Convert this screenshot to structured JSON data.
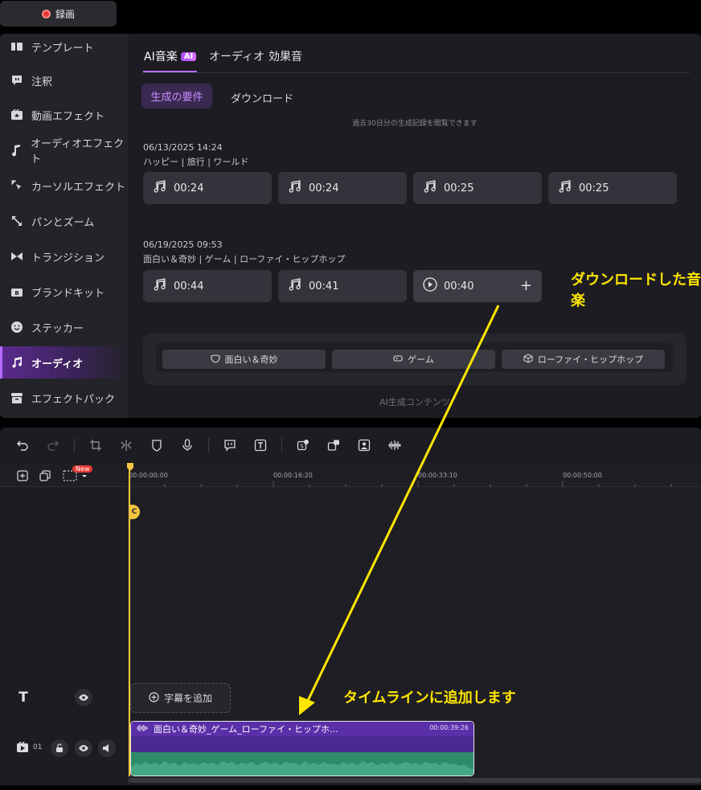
{
  "record": {
    "label": "録画"
  },
  "sidebar": {
    "items": [
      {
        "label": "テンプレート",
        "icon": "template-icon"
      },
      {
        "label": "注釈",
        "icon": "annotation-icon"
      },
      {
        "label": "動画エフェクト",
        "icon": "video-effect-icon"
      },
      {
        "label": "オーディオエフェクト",
        "icon": "audio-effect-icon"
      },
      {
        "label": "カーソルエフェクト",
        "icon": "cursor-effect-icon"
      },
      {
        "label": "パンとズーム",
        "icon": "pan-zoom-icon"
      },
      {
        "label": "トランジション",
        "icon": "transition-icon"
      },
      {
        "label": "ブランドキット",
        "icon": "brand-kit-icon"
      },
      {
        "label": "ステッカー",
        "icon": "sticker-icon"
      },
      {
        "label": "オーディオ",
        "icon": "music-note-icon",
        "active": true
      },
      {
        "label": "エフェクトパック",
        "icon": "effect-pack-icon"
      }
    ]
  },
  "tabs": {
    "ai_music": "AI音楽",
    "ai_badge": "AI",
    "audio": "オーディオ",
    "sfx": "効果音"
  },
  "subtabs": {
    "generate": "生成の要件",
    "download": "ダウンロード"
  },
  "history_note": "過去30日分の生成記録を閲覧できます",
  "groups": [
    {
      "date": "06/13/2025 14:24",
      "tags": "ハッピー | 旅行 | ワールド",
      "tracks": [
        "00:24",
        "00:24",
        "00:25",
        "00:25"
      ]
    },
    {
      "date": "06/19/2025 09:53",
      "tags": "面白い＆奇妙 | ゲーム | ローファイ・ヒップホップ",
      "tracks": [
        "00:44",
        "00:41",
        "00:40"
      ]
    }
  ],
  "callouts": {
    "downloaded": "ダウンロードした音楽",
    "add_to_timeline": "タイムラインに追加します"
  },
  "tag_buttons": [
    "面白い＆奇妙",
    "ゲーム",
    "ローファイ・ヒップホップ"
  ],
  "ai_content_note": "AI生成コンテンツ",
  "timeline": {
    "new_badge": "New",
    "ruler": [
      "00:00:00:00",
      "00:00:16:20",
      "00:00:33:10",
      "00:00:50:00"
    ],
    "add_caption": "字幕を追加",
    "track_number": "01",
    "clip_title": "面白い＆奇妙_ゲーム_ローファイ・ヒップホ...",
    "clip_duration": "00:00:39:26"
  },
  "colors": {
    "accent": "#b66cff",
    "callout": "#ffe600",
    "playhead": "#f5c542",
    "clip_header": "#5a2fa8",
    "waveform": "#2e8b6a"
  }
}
